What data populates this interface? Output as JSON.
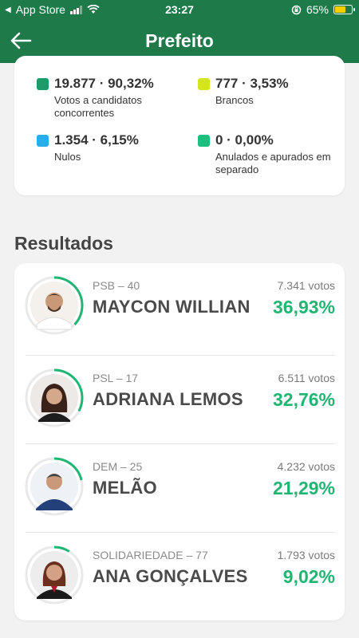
{
  "statusbar": {
    "back_app": "App Store",
    "time": "23:27",
    "battery": "65%",
    "battery_level": 0.65
  },
  "header": {
    "title": "Prefeito"
  },
  "summary": {
    "items": [
      {
        "value": "19.877 · 90,32%",
        "label": "Votos a candidatos concorrentes",
        "color": "#1e9a6b"
      },
      {
        "value": "777 · 3,53%",
        "label": "Brancos",
        "color": "#d4e61b"
      },
      {
        "value": "1.354 · 6,15%",
        "label": "Nulos",
        "color": "#27aee8"
      },
      {
        "value": "0 · 0,00%",
        "label": "Anulados e apurados em separado",
        "color": "#1ac07e"
      }
    ]
  },
  "results": {
    "heading": "Resultados",
    "candidates": [
      {
        "party": "PSB – 40",
        "name": "MAYCON WILLIAN",
        "votes": "7.341 votos",
        "percent": "36,93%",
        "share": 0.3693
      },
      {
        "party": "PSL – 17",
        "name": "ADRIANA LEMOS",
        "votes": "6.511 votos",
        "percent": "32,76%",
        "share": 0.3276
      },
      {
        "party": "DEM – 25",
        "name": "MELÃO",
        "votes": "4.232 votos",
        "percent": "21,29%",
        "share": 0.2129
      },
      {
        "party": "SOLIDARIEDADE – 77",
        "name": "ANA GONÇALVES",
        "votes": "1.793 votos",
        "percent": "9,02%",
        "share": 0.0902
      }
    ]
  },
  "colors": {
    "brand": "#1f7a4a",
    "accent": "#21b573"
  }
}
